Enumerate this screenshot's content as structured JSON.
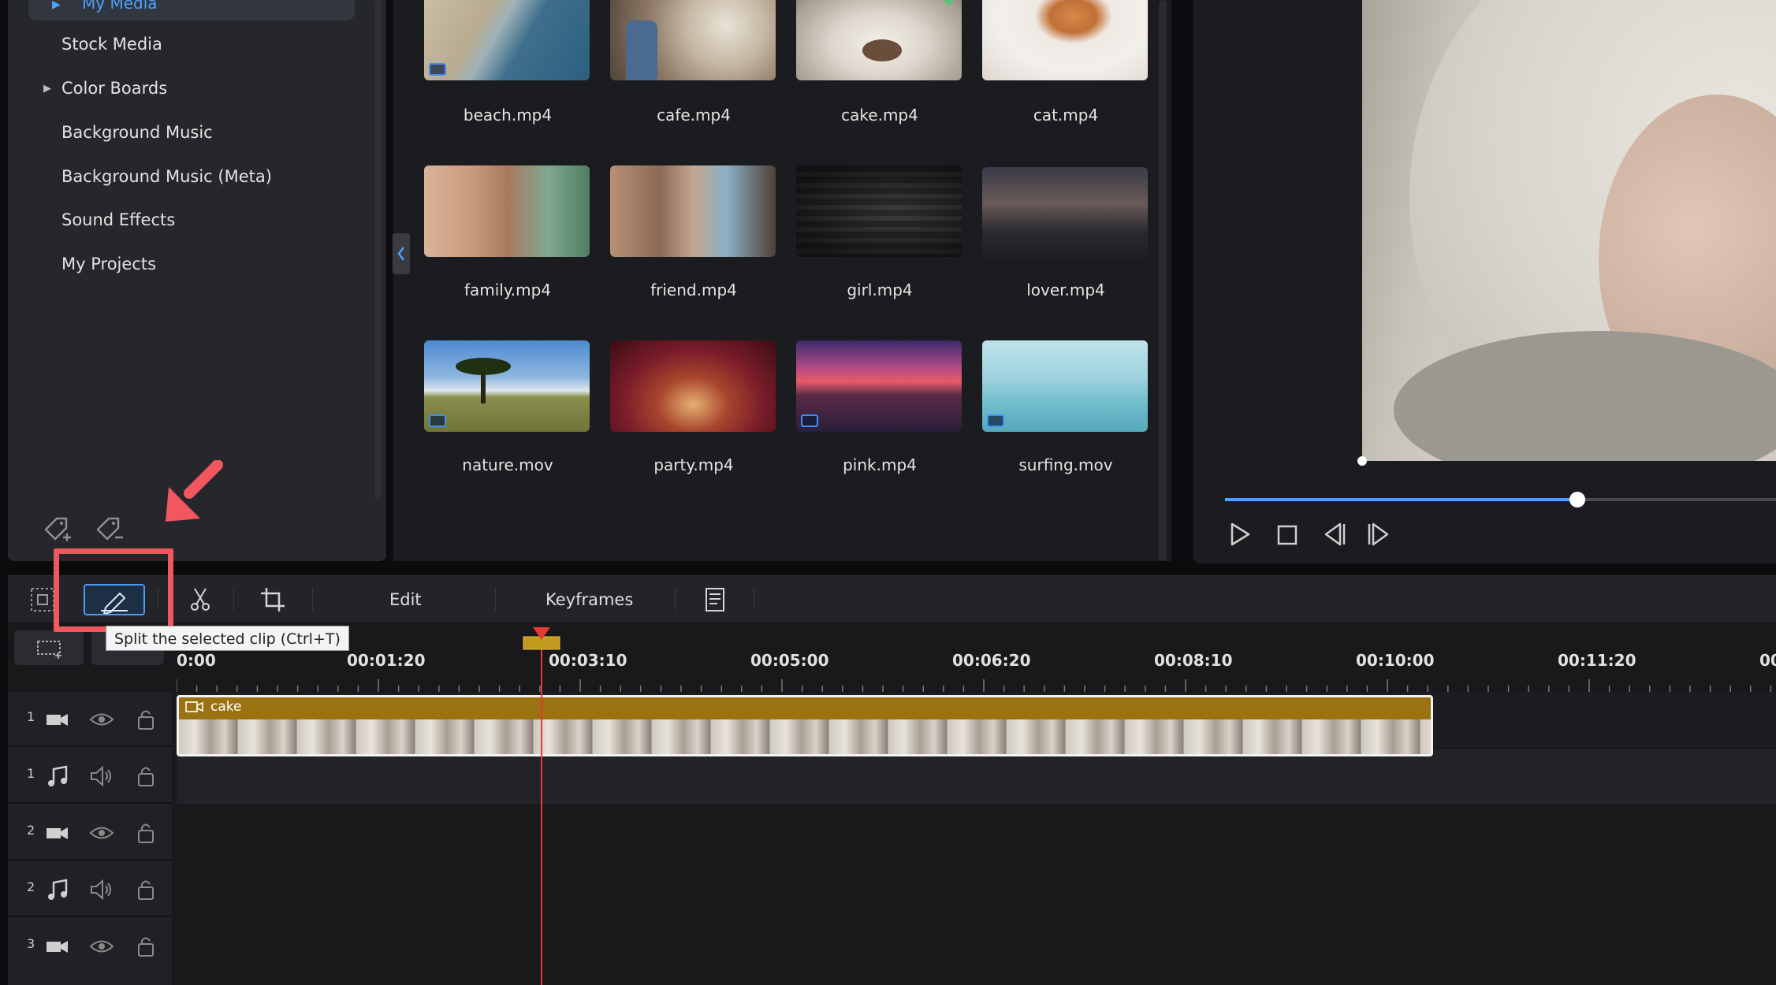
{
  "library": {
    "current_item": "My Media",
    "items": [
      {
        "label": "Stock Media",
        "expandable": false
      },
      {
        "label": "Color Boards",
        "expandable": true
      },
      {
        "label": "Background Music",
        "expandable": false
      },
      {
        "label": "Background Music (Meta)",
        "expandable": false
      },
      {
        "label": "Sound Effects",
        "expandable": false
      },
      {
        "label": "My Projects",
        "expandable": false
      }
    ]
  },
  "media": {
    "files": [
      {
        "name": "beach.mp4"
      },
      {
        "name": "cafe.mp4"
      },
      {
        "name": "cake.mp4"
      },
      {
        "name": "cat.mp4"
      },
      {
        "name": "family.mp4"
      },
      {
        "name": "friend.mp4"
      },
      {
        "name": "girl.mp4"
      },
      {
        "name": "lover.mp4"
      },
      {
        "name": "nature.mov"
      },
      {
        "name": "party.mp4"
      },
      {
        "name": "pink.mp4"
      },
      {
        "name": "surfing.mov"
      }
    ]
  },
  "preview": {
    "progress": 0.64
  },
  "toolbar": {
    "edit_label": "Edit",
    "keyframes_label": "Keyframes",
    "tooltip": "Split the selected clip (Ctrl+T)"
  },
  "timeline": {
    "ruler": [
      "0:00",
      "00:01:20",
      "00:03:10",
      "00:05:00",
      "00:06:20",
      "00:08:10",
      "00:10:00",
      "00:11:20",
      "00"
    ],
    "tracks": [
      {
        "num": "1",
        "type": "video",
        "control": "eye"
      },
      {
        "num": "1",
        "type": "audio",
        "control": "speaker"
      },
      {
        "num": "2",
        "type": "video",
        "control": "eye"
      },
      {
        "num": "2",
        "type": "audio",
        "control": "speaker"
      },
      {
        "num": "3",
        "type": "video",
        "control": "eye"
      }
    ],
    "clip": {
      "title": "cake"
    }
  },
  "colors": {
    "accent": "#4aa3ff",
    "highlight": "#f0575e",
    "clip": "#9a7212",
    "playhead": "#e53935"
  }
}
